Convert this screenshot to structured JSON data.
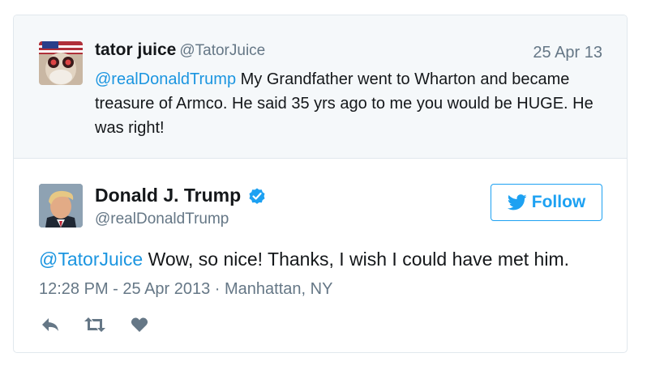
{
  "parent_tweet": {
    "name": "tator juice",
    "handle": "@TatorJuice",
    "date": "25 Apr 13",
    "mention": "@realDonaldTrump",
    "text": " My Grandfather went to Wharton and became treasure of Armco. He said 35 yrs ago to me you would be HUGE. He was right!"
  },
  "tweet": {
    "name": "Donald J. Trump",
    "handle": "@realDonaldTrump",
    "verified_icon": "verified-badge-icon",
    "follow_label": "Follow",
    "mention": "@TatorJuice",
    "text": " Wow, so nice! Thanks, I wish I could have met him.",
    "timestamp": "12:28 PM - 25 Apr 2013 · Manhattan, NY"
  },
  "actions": {
    "reply_icon": "reply-icon",
    "retweet_icon": "retweet-icon",
    "like_icon": "heart-icon"
  },
  "colors": {
    "link": "#1b95e0",
    "accent": "#1da1f2",
    "muted": "#657786",
    "parent_bg": "#f5f8fa",
    "icon": "#657786"
  }
}
